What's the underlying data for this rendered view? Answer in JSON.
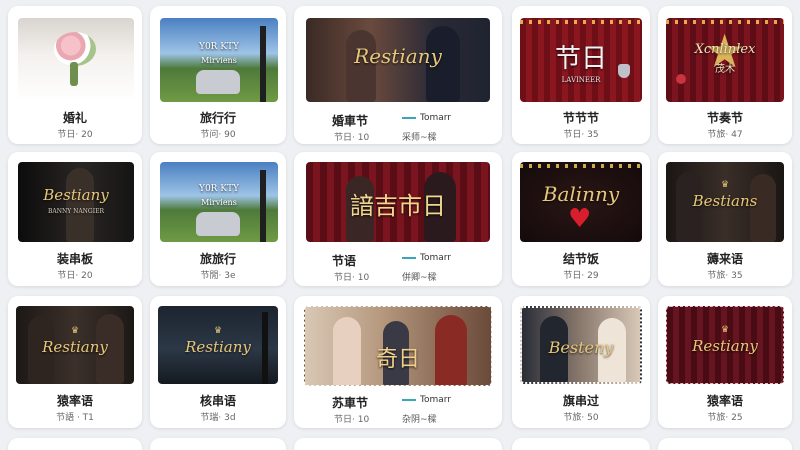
{
  "cards": [
    {
      "id": "r1c1",
      "title": "婚礼",
      "sub": "节日· 20",
      "overlay": "",
      "thumb": "wedding"
    },
    {
      "id": "r1c2",
      "title": "旅行行",
      "sub": "节问· 90",
      "overlay": "Y0R KTY",
      "overlay2": "Mirviens",
      "thumb": "car"
    },
    {
      "id": "r1c3",
      "title": "婚車节",
      "sub": "节日· 10",
      "overlay": "Restiany",
      "tag": "Tomarr",
      "tag2": "采师~樑",
      "thumb": "couple"
    },
    {
      "id": "r1c4",
      "title": "节节节",
      "sub": "节日· 35",
      "overlay": "节日",
      "overlay2": "LAVINEER",
      "thumb": "redcurtain"
    },
    {
      "id": "r1c5",
      "title": "节奏节",
      "sub": "节旅· 47",
      "overlay": "Xcnlinlex",
      "overlay2": "茂木",
      "thumb": "star"
    },
    {
      "id": "r2c1",
      "title": "装串板",
      "sub": "节日· 20",
      "overlay": "Bestiany",
      "overlay2": "BANNY NANGIER",
      "thumb": "dark"
    },
    {
      "id": "r2c2",
      "title": "旅旅行",
      "sub": "节閒· 3e",
      "overlay": "Y0R KTY",
      "overlay2": "Mirviens",
      "thumb": "car"
    },
    {
      "id": "r2c3",
      "title": "节语",
      "sub": "节日· 10",
      "overlay": "諳吉市日",
      "tag": "Tomarr",
      "tag2": "併卿~樑",
      "thumb": "dinner"
    },
    {
      "id": "r2c4",
      "title": "结节饭",
      "sub": "节日· 29",
      "overlay": "Balinny",
      "thumb": "heart"
    },
    {
      "id": "r2c5",
      "title": "薅来语",
      "sub": "节旅· 35",
      "overlay": "Bestians",
      "thumb": "darkcouple"
    },
    {
      "id": "r3c1",
      "title": "猿率语",
      "sub": "节語 · T1",
      "overlay": "Restiany",
      "thumb": "darkcouple"
    },
    {
      "id": "r3c2",
      "title": "核串语",
      "sub": "节瑞· 3d",
      "overlay": "Restiany",
      "thumb": "lamp"
    },
    {
      "id": "r3c3",
      "title": "苏車节",
      "sub": "节日· 10",
      "overlay": "奇日",
      "tag": "Tomarr",
      "tag2": "杂阴~樑",
      "thumb": "family"
    },
    {
      "id": "r3c4",
      "title": "旗串过",
      "sub": "节旅· 50",
      "overlay": "Besteny",
      "thumb": "stamp"
    },
    {
      "id": "r3c5",
      "title": "猿率语",
      "sub": "节旅· 25",
      "overlay": "Restiany",
      "thumb": "darkred"
    }
  ]
}
